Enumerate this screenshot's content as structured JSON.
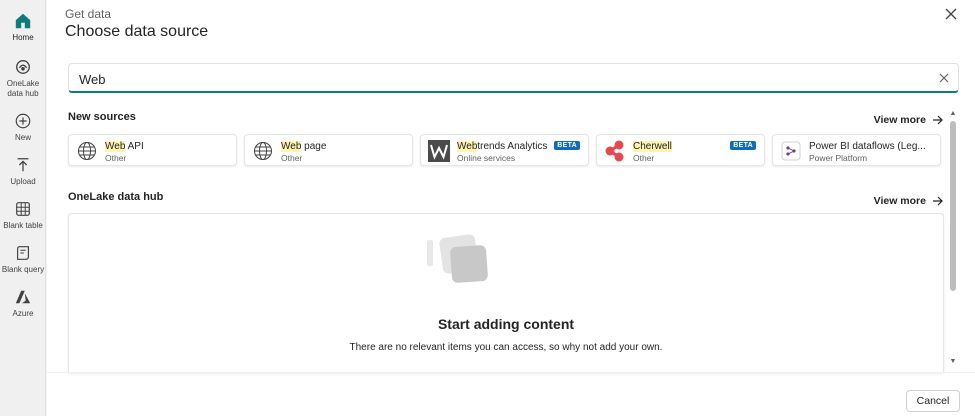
{
  "rail": {
    "items": [
      {
        "label": "Home",
        "icon": "home-icon"
      },
      {
        "label": "OneLake\ndata hub",
        "icon": "onelake-icon"
      },
      {
        "label": "New",
        "icon": "plus-circle-icon"
      },
      {
        "label": "Upload",
        "icon": "upload-icon"
      },
      {
        "label": "Blank table",
        "icon": "table-icon"
      },
      {
        "label": "Blank query",
        "icon": "query-icon"
      },
      {
        "label": "Azure",
        "icon": "azure-icon"
      }
    ]
  },
  "dialog": {
    "eyebrow": "Get data",
    "title": "Choose data source",
    "search_value": "Web",
    "cancel_label": "Cancel"
  },
  "new_sources": {
    "heading": "New sources",
    "view_more": "View more",
    "cards": [
      {
        "match": "Web",
        "rest": " API",
        "sub": "Other",
        "icon": "globe-icon",
        "badge": ""
      },
      {
        "match": "Web",
        "rest": " page",
        "sub": "Other",
        "icon": "globe-icon",
        "badge": ""
      },
      {
        "match": "Web",
        "rest": "trends Analytics",
        "sub": "Online services",
        "icon": "webtrends-logo-icon",
        "badge": "BETA"
      },
      {
        "match": "Cherwell",
        "rest": "",
        "sub": "Other",
        "icon": "cherwell-logo-icon",
        "badge": "BETA"
      },
      {
        "match": "Power BI dataflows (Leg...",
        "rest": "",
        "sub": "Power Platform",
        "icon": "dataflow-icon",
        "badge": ""
      }
    ]
  },
  "hub": {
    "heading": "OneLake data hub",
    "view_more": "View more",
    "empty_title": "Start adding content",
    "empty_desc": "There are no relevant items you can access, so why not add your own."
  },
  "colors": {
    "accent": "#0f7c7c",
    "badge": "#0f6cbd",
    "highlight": "#fff3b0"
  }
}
